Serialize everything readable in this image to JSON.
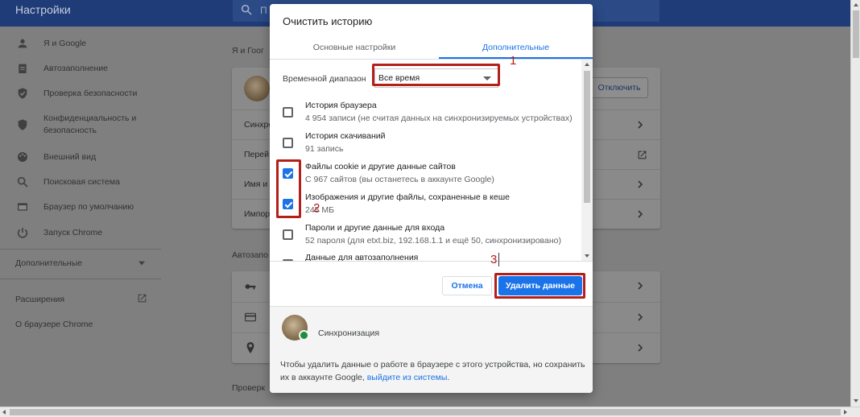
{
  "settings": {
    "title": "Настройки",
    "search_placeholder": "П",
    "sidebar": [
      {
        "label": "Я и Google",
        "icon": "person-icon"
      },
      {
        "label": "Автозаполнение",
        "icon": "clipboard-icon"
      },
      {
        "label": "Проверка безопасности",
        "icon": "shield-check-icon"
      },
      {
        "label": "Конфиденциальность и безопасность",
        "icon": "shield-icon"
      },
      {
        "label": "Внешний вид",
        "icon": "palette-icon"
      },
      {
        "label": "Поисковая система",
        "icon": "search-icon"
      },
      {
        "label": "Браузер по умолчанию",
        "icon": "browser-icon"
      },
      {
        "label": "Запуск Chrome",
        "icon": "power-icon"
      }
    ],
    "advanced_label": "Дополнительные",
    "extensions_label": "Расширения",
    "about_label": "О браузере Chrome",
    "section_me": "Я и Гоог",
    "disconnect_button": "Отключить",
    "rows_me": [
      "Синхро",
      "Перей",
      "Имя и",
      "Импор"
    ],
    "section_autofill": "Автозапо",
    "section_check": "Проверк"
  },
  "dialog": {
    "title": "Очистить историю",
    "tab_basic": "Основные настройки",
    "tab_advanced": "Дополнительные",
    "range_label": "Временной диапазон",
    "range_value": "Все время",
    "options": [
      {
        "name": "История браузера",
        "desc": "4 954 записи (не считая данных на синхронизируемых устройствах)",
        "checked": false
      },
      {
        "name": "История скачиваний",
        "desc": "91 запись",
        "checked": false
      },
      {
        "name": "Файлы cookie и другие данные сайтов",
        "desc": "С 967 сайтов (вы останетесь в аккаунте Google)",
        "checked": true
      },
      {
        "name": "Изображения и другие файлы, сохраненные в кеше",
        "desc": "245 МБ",
        "checked": true
      },
      {
        "name": "Пароли и другие данные для входа",
        "desc": "52 пароля (для etxt.biz, 192.168.1.1 и ещё 50, синхронизировано)",
        "checked": false
      },
      {
        "name": "Данные для автозаполнения",
        "desc": "",
        "checked": false
      }
    ],
    "cancel_button": "Отмена",
    "delete_button": "Удалить данные",
    "sync_label": "Синхронизация",
    "footer_text": "Чтобы удалить данные о работе в браузере с этого устройства, но сохранить их в аккаунте Google,",
    "footer_link": "выйдите из системы",
    "footer_end": "."
  },
  "annotations": [
    "1",
    "2",
    "3"
  ],
  "colors": {
    "accent": "#1a73e8",
    "annotation": "#b3201b",
    "topbar": "#1f3c78"
  }
}
